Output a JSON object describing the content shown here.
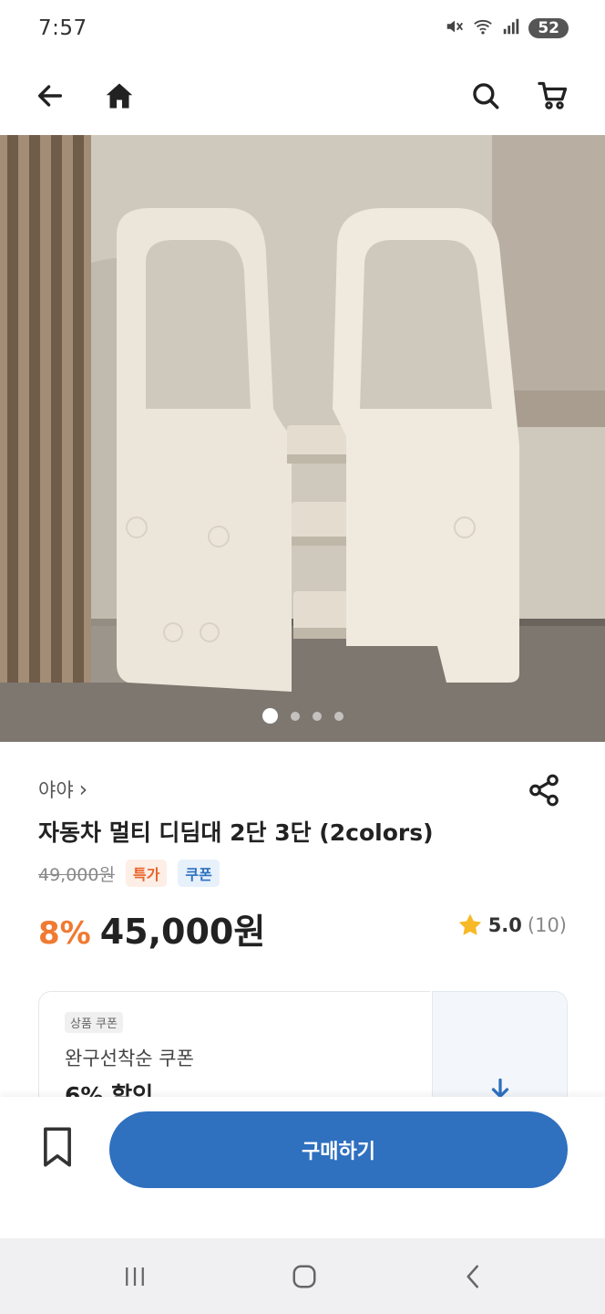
{
  "status_bar": {
    "time": "7:57",
    "battery": "52",
    "icons": [
      "mute-icon",
      "wifi-icon",
      "signal-icon"
    ]
  },
  "top_nav": {
    "icons": [
      "back-arrow-icon",
      "home-icon",
      "search-icon",
      "cart-icon"
    ]
  },
  "gallery": {
    "image_count": 4,
    "active_index": 0
  },
  "product": {
    "brand": "야야",
    "brand_chevron": "›",
    "title": "자동차 멀티 디딤대 2단 3단 (2colors)",
    "original_price": "49,000원",
    "badges": {
      "sale": "특가",
      "coupon": "쿠폰"
    },
    "discount_rate": "8%",
    "price": "45,000원",
    "rating_score": "5.0",
    "rating_count": "(10)"
  },
  "coupon": {
    "tag": "상품 쿠폰",
    "name": "완구선착순 쿠폰",
    "discount": "6% 할인"
  },
  "action_bar": {
    "buy_label": "구매하기"
  },
  "colors": {
    "accent_blue": "#2f70bf",
    "discount_orange": "#f07a32",
    "star_yellow": "#f7b928"
  }
}
